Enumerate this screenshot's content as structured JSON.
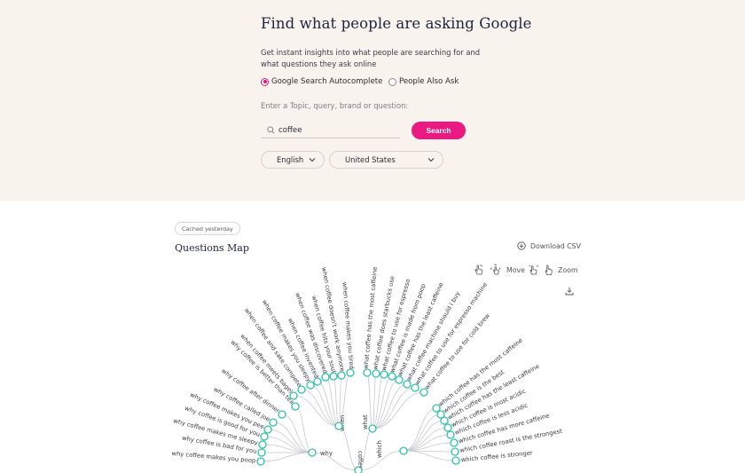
{
  "hero": {
    "title": "Find what people are asking Google",
    "subtitle": "Get instant insights into what people are searching for and what questions they ask online",
    "modes": [
      {
        "label": "Google Search Autocomplete",
        "selected": true
      },
      {
        "label": "People Also Ask",
        "selected": false
      }
    ],
    "prompt": "Enter a Topic, query, brand or question:",
    "query": "coffee",
    "search_label": "Search",
    "language": "English",
    "country": "United States"
  },
  "map": {
    "cached_badge": "Cached yesterday",
    "title": "Questions Map",
    "download_label": "Download CSV",
    "move_label": "Move",
    "zoom_label": "Zoom",
    "root": "coffee",
    "branches": [
      {
        "name": "why",
        "items": [
          "why coffee is better than tea",
          "why coffee after dinner",
          "why coffee called joe",
          "why coffee makes you pee",
          "why coffee is good for you",
          "why coffee makes me sleepy",
          "why coffee is bad for you",
          "why coffee makes you poop"
        ]
      },
      {
        "name": "when",
        "items": [
          "when coffee makes you tired",
          "when coffee doesn't work anymore",
          "when coffee hits your soul",
          "when coffee was discovered",
          "when coffee invented",
          "when coffee makes you sleepy",
          "when coffee and sake compete",
          "when coffee meets bagel"
        ]
      },
      {
        "name": "what",
        "items": [
          "what coffee has the most caffeine",
          "what coffee does starbucks use",
          "what coffee to use for espresso",
          "what coffee is made from poop",
          "what coffee has the least caffeine",
          "what coffee machine should i buy",
          "what coffee to use for espresso machine",
          "what coffee to use for cold brew"
        ]
      },
      {
        "name": "which",
        "items": [
          "which coffee has the most caffeine",
          "which coffee is the best",
          "which coffee has the least caffeine",
          "which coffee is most acidic",
          "which coffee is less acidic",
          "which coffee has more caffeine",
          "which coffee roast is the strongest",
          "which coffee is stronger"
        ]
      }
    ]
  },
  "colors": {
    "accent": "#ea1a82",
    "node_stroke": "#2ec4a6",
    "hero_bg": "#f9f3ee",
    "heading": "#1e2340"
  },
  "icons": [
    "search-icon",
    "chevron-down-icon",
    "download-icon",
    "pointer-hand-icon",
    "move-icon",
    "hand-zoom-icon",
    "export-icon"
  ]
}
